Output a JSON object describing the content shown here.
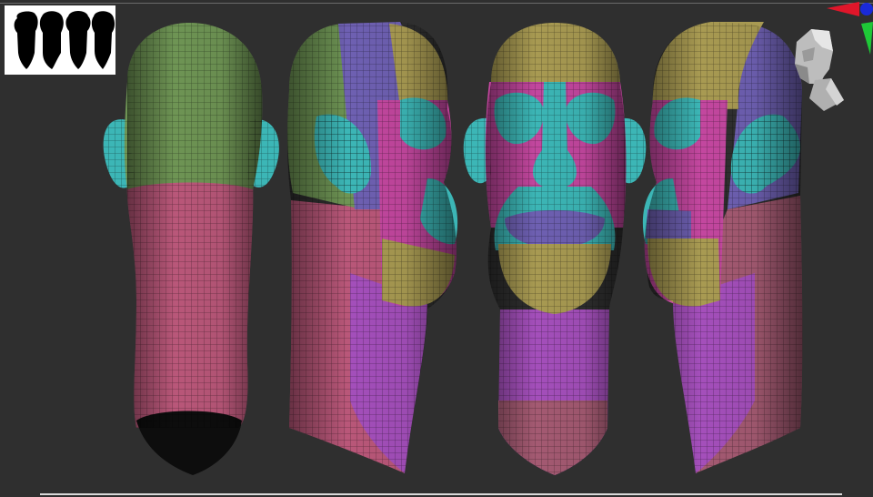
{
  "viewport": {
    "background": "#2f2f2f",
    "materials": {
      "green": "#6e9454",
      "pink": "#b95779",
      "cyan": "#3cb6b6",
      "purple": "#a44fbb",
      "violet": "#6e60b2",
      "yellow": "#a89a52",
      "magenta": "#c3479f",
      "mauve": "#a45a72"
    },
    "views": [
      {
        "name": "back"
      },
      {
        "name": "side-right"
      },
      {
        "name": "front"
      },
      {
        "name": "side-left"
      }
    ],
    "gizmo": {
      "x_axis_color": "#e0162a",
      "y_axis_color": "#1ec837",
      "z_axis_color": "#1a2ad8"
    }
  }
}
